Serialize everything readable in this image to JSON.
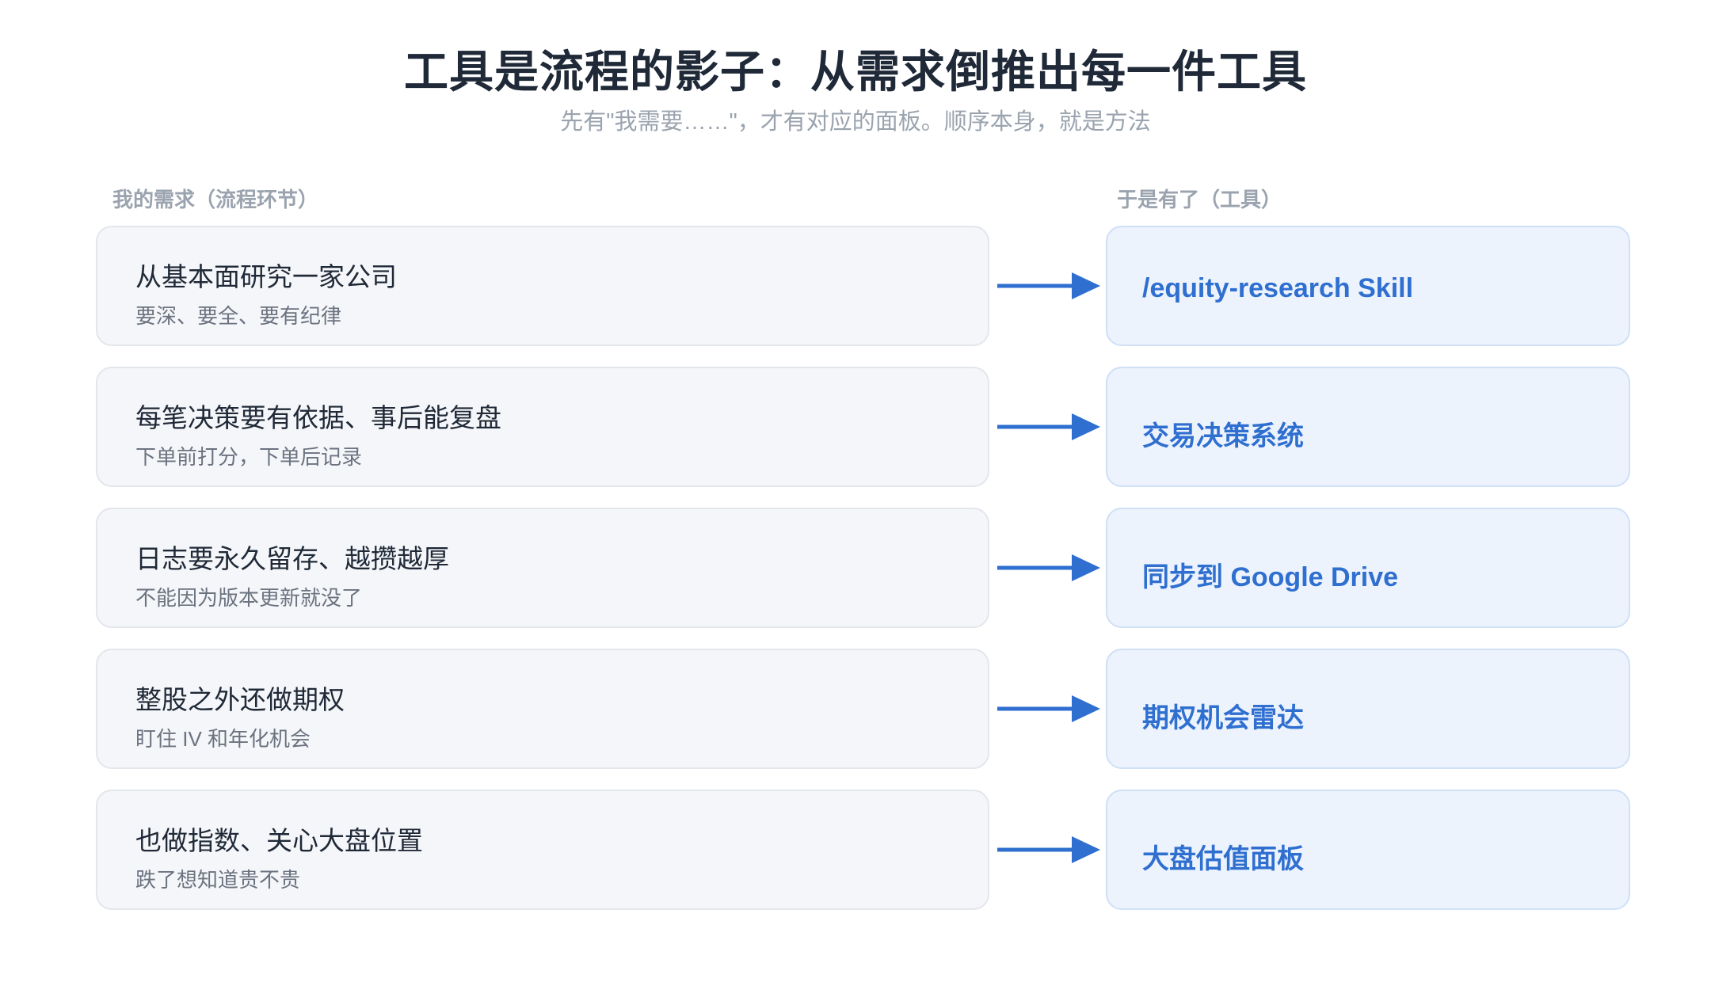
{
  "title": "工具是流程的影子：从需求倒推出每一件工具",
  "subtitle": "先有\"我需要……\"，才有对应的面板。顺序本身，就是方法",
  "headers": {
    "needs": "我的需求（流程环节）",
    "tools": "于是有了（工具）"
  },
  "colors": {
    "accent": "#2f6fd0",
    "arrow": "#2f6fd0",
    "need_bg": "#f5f6f9",
    "tool_bg": "#edf3fd"
  },
  "rows": [
    {
      "need_title": "从基本面研究一家公司",
      "need_sub": "要深、要全、要有纪律",
      "tool": "/equity-research Skill"
    },
    {
      "need_title": "每笔决策要有依据、事后能复盘",
      "need_sub": "下单前打分，下单后记录",
      "tool": "交易决策系统"
    },
    {
      "need_title": "日志要永久留存、越攒越厚",
      "need_sub": "不能因为版本更新就没了",
      "tool": "同步到 Google Drive"
    },
    {
      "need_title": "整股之外还做期权",
      "need_sub": "盯住 IV 和年化机会",
      "tool": "期权机会雷达"
    },
    {
      "need_title": "也做指数、关心大盘位置",
      "need_sub": "跌了想知道贵不贵",
      "tool": "大盘估值面板"
    }
  ]
}
